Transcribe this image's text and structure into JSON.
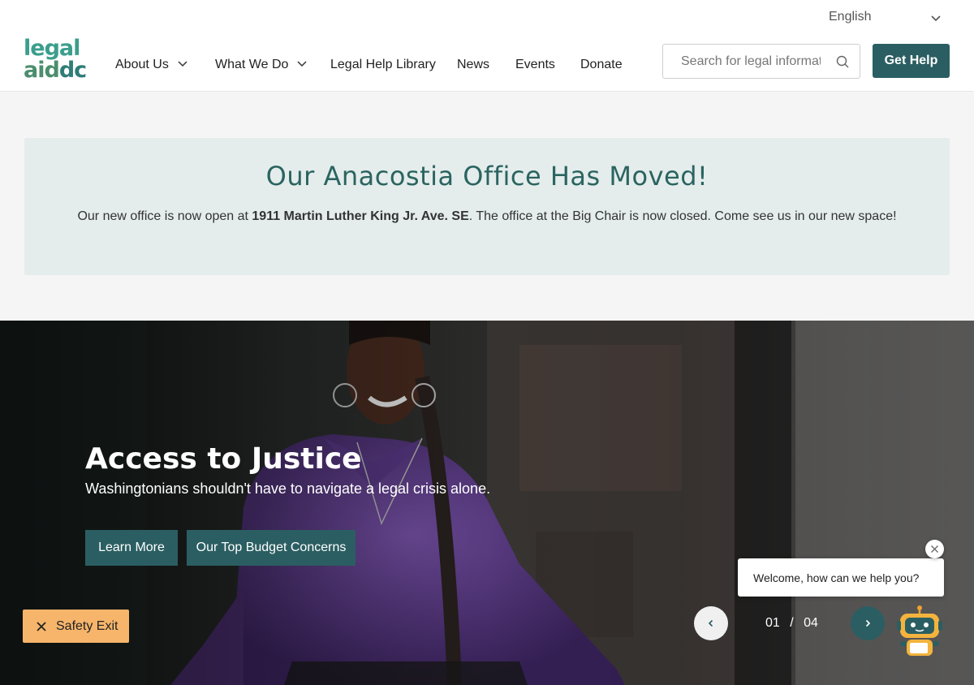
{
  "header": {
    "language": "English",
    "logo": {
      "line1": "legal",
      "line2a": "aid",
      "line2b": "dc"
    },
    "nav": [
      {
        "label": "About Us",
        "has_dropdown": true
      },
      {
        "label": "What We Do",
        "has_dropdown": true
      },
      {
        "label": "Legal Help Library",
        "has_dropdown": false
      },
      {
        "label": "News",
        "has_dropdown": false
      },
      {
        "label": "Events",
        "has_dropdown": false
      },
      {
        "label": "Donate",
        "has_dropdown": false
      }
    ],
    "search": {
      "placeholder": "Search for legal information",
      "icon": "search-icon"
    },
    "get_help_label": "Get Help"
  },
  "alert": {
    "title": "Our Anacostia Office Has Moved!",
    "text_before": "Our new office is now open at ",
    "text_bold": "1911 Martin Luther King Jr. Ave. SE",
    "text_after": ". The office at the Big Chair is now closed. Come see us in our new space!"
  },
  "hero": {
    "title": "Access to Justice",
    "subtitle": "Washingtonians shouldn't have to navigate a legal crisis alone.",
    "buttons": [
      "Learn More",
      "Our Top Budget Concerns"
    ],
    "slide_current": "01",
    "slide_separator": "/",
    "slide_total": "04"
  },
  "safety_exit": {
    "label": "Safety Exit",
    "icon": "close-icon"
  },
  "chat": {
    "message": "Welcome, how can we help you?",
    "icon": "chatbot-robot-icon"
  },
  "colors": {
    "accent": "#2b5e62",
    "alert_bg": "#e4edec",
    "alert_title": "#2b6460",
    "safety": "#f6b56b",
    "logo_green": "#3a9e8c"
  }
}
